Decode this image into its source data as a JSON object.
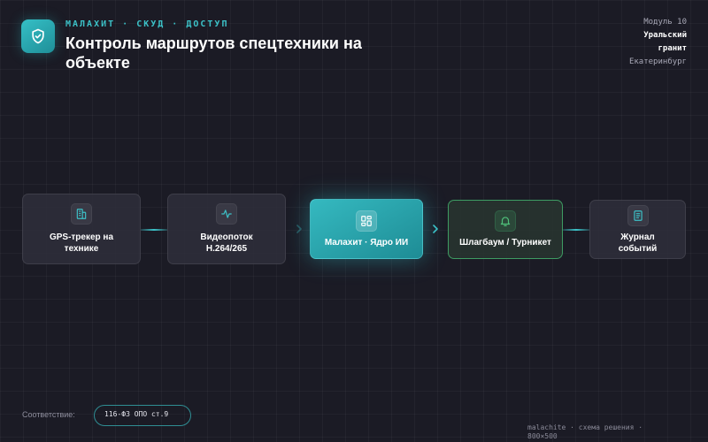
{
  "header": {
    "kicker": "МАЛАХИТ · СКУД · ДОСТУП",
    "title": "Контроль маршрутов спецтехники на объекте"
  },
  "meta": {
    "module": "Модуль 10",
    "client_line1": "Уральский",
    "client_line2": "гранит",
    "city": "Екатеринбург"
  },
  "flow": [
    {
      "label": "GPS-трекер на технике",
      "icon": "building-icon"
    },
    {
      "label": "Видеопоток H.264/265",
      "icon": "activity-icon"
    },
    {
      "label": "Малахит · Ядро ИИ",
      "icon": "grid-icon"
    },
    {
      "label": "Шлагбаум / Турникет",
      "icon": "bell-icon"
    },
    {
      "label": "Журнал событий",
      "icon": "document-icon"
    }
  ],
  "compliance": {
    "label": "Соответствие:",
    "value": "116-ФЗ ОПО ст.9"
  },
  "footer": "malachite · схема решения · 800×500",
  "colors": {
    "accent": "#3cc2c8",
    "core": "#2aa4ac",
    "gate_border": "#3e9c63",
    "background": "#1b1b25"
  }
}
